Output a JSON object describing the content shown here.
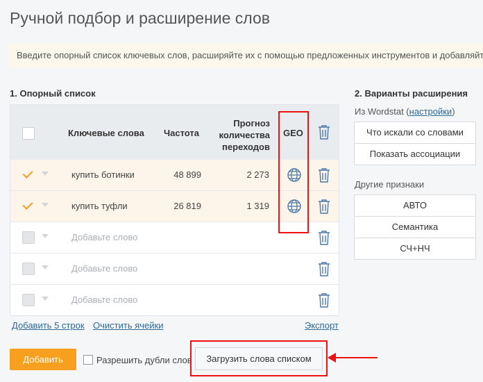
{
  "page": {
    "title": "Ручной подбор и расширение слов",
    "hint": "Введите опорный список ключевых слов, расширяйте их с помощью предложенных инструментов и добавляйте"
  },
  "reference": {
    "heading": "1. Опорный список",
    "columns": {
      "keywords": "Ключевые слова",
      "frequency": "Частота",
      "forecast": "Прогноз количества переходов",
      "geo": "GEO"
    },
    "rows": [
      {
        "keyword": "купить ботинки",
        "frequency": "48 899",
        "forecast": "2 273"
      },
      {
        "keyword": "купить туфли",
        "frequency": "26 819",
        "forecast": "1 319"
      }
    ],
    "placeholder": "Добавьте слово",
    "links": {
      "add_rows": "Добавить 5 строк",
      "clear": "Очистить ячейки",
      "export": "Экспорт"
    }
  },
  "actions": {
    "add": "Добавить",
    "allow_dupes": "Разрешить дубли слов",
    "load_list": "Загрузить слова списком"
  },
  "expansion": {
    "heading": "2. Варианты расширения",
    "wordstat_prefix": "Из Wordstat (",
    "wordstat_link": "настройки",
    "wordstat_suffix": ")",
    "wordstat_options": [
      "Что искали со словами",
      "Показать ассоциации"
    ],
    "other_label": "Другие признаки",
    "other_options": [
      "АВТО",
      "Семантика",
      "СЧ+НЧ"
    ]
  },
  "colors": {
    "accent": "#f7a01f",
    "link": "#2b6a9a",
    "highlight": "#ee1111"
  },
  "icons": {
    "globe": "globe-icon",
    "trash": "trash-icon",
    "caret": "chevron-down-icon"
  }
}
